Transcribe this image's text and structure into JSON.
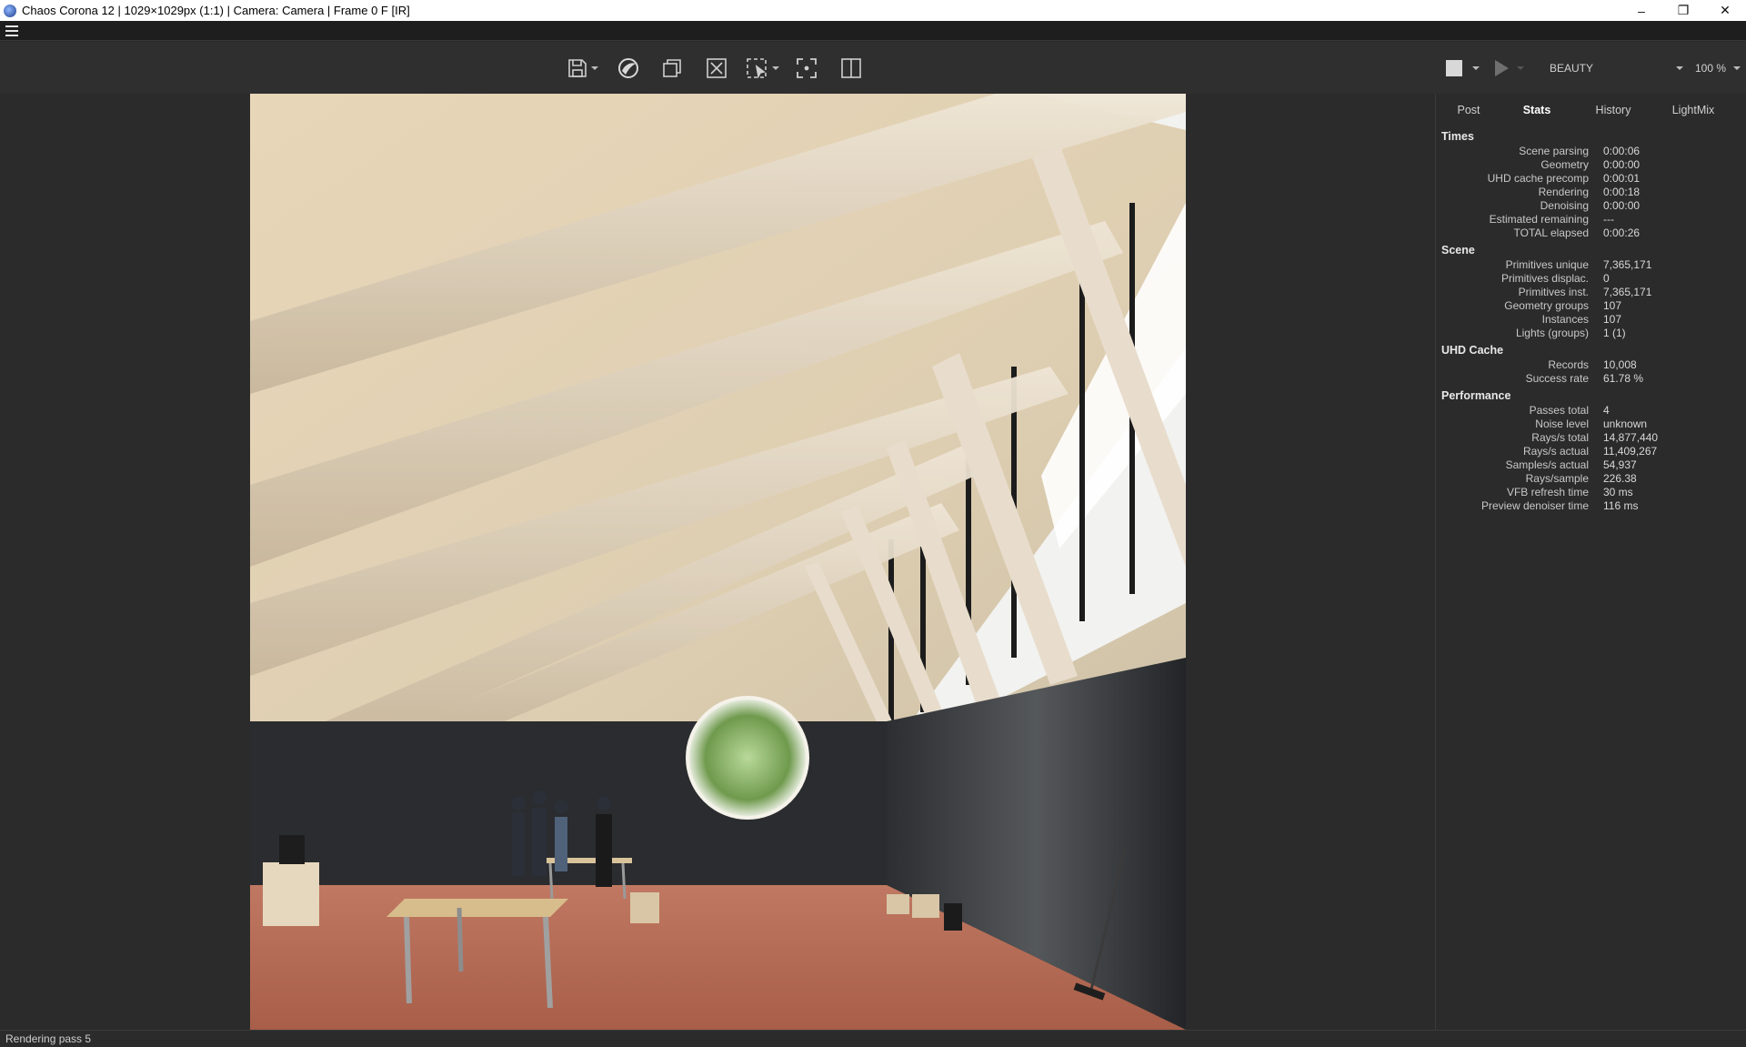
{
  "window": {
    "title": "Chaos Corona 12 | 1029×1029px (1:1) | Camera: Camera | Frame 0 F [IR]",
    "minimize": "–",
    "restore": "❐",
    "close": "✕"
  },
  "toolbar": {
    "icons": [
      "save-icon",
      "corona-logo-icon",
      "copy-icon",
      "clear-icon",
      "region-render-icon",
      "fit-view-icon",
      "split-view-icon"
    ],
    "pass_select": "BEAUTY",
    "zoom": "100 %"
  },
  "tabs": [
    {
      "label": "Post",
      "active": false
    },
    {
      "label": "Stats",
      "active": true
    },
    {
      "label": "History",
      "active": false
    },
    {
      "label": "LightMix",
      "active": false
    }
  ],
  "stats": {
    "times": {
      "title": "Times",
      "rows": [
        {
          "label": "Scene parsing",
          "value": "0:00:06"
        },
        {
          "label": "Geometry",
          "value": "0:00:00"
        },
        {
          "label": "UHD cache precomp",
          "value": "0:00:01"
        },
        {
          "label": "Rendering",
          "value": "0:00:18"
        },
        {
          "label": "Denoising",
          "value": "0:00:00"
        },
        {
          "label": "Estimated remaining",
          "value": "---"
        },
        {
          "label": "TOTAL elapsed",
          "value": "0:00:26"
        }
      ]
    },
    "scene": {
      "title": "Scene",
      "rows": [
        {
          "label": "Primitives unique",
          "value": "7,365,171"
        },
        {
          "label": "Primitives displac.",
          "value": "0"
        },
        {
          "label": "Primitives inst.",
          "value": "7,365,171"
        },
        {
          "label": "Geometry groups",
          "value": "107"
        },
        {
          "label": "Instances",
          "value": "107"
        },
        {
          "label": "Lights (groups)",
          "value": "1 (1)"
        }
      ]
    },
    "uhd": {
      "title": "UHD Cache",
      "rows": [
        {
          "label": "Records",
          "value": "10,008"
        },
        {
          "label": "Success rate",
          "value": "61.78 %"
        }
      ]
    },
    "performance": {
      "title": "Performance",
      "rows": [
        {
          "label": "Passes total",
          "value": "4"
        },
        {
          "label": "Noise level",
          "value": "unknown"
        },
        {
          "label": "Rays/s total",
          "value": "14,877,440"
        },
        {
          "label": "Rays/s actual",
          "value": "11,409,267"
        },
        {
          "label": "Samples/s actual",
          "value": "54,937"
        },
        {
          "label": "Rays/sample",
          "value": "226.38"
        },
        {
          "label": "VFB refresh time",
          "value": "30 ms"
        },
        {
          "label": "Preview denoiser time",
          "value": "116 ms"
        }
      ]
    }
  },
  "status": "Rendering pass 5",
  "colors": {
    "background": "#2b2b2b",
    "toolbar": "#2f2f2f",
    "floor": "#b36a55",
    "wood": "#e3d3b6",
    "wall": "#2a2c2f"
  }
}
